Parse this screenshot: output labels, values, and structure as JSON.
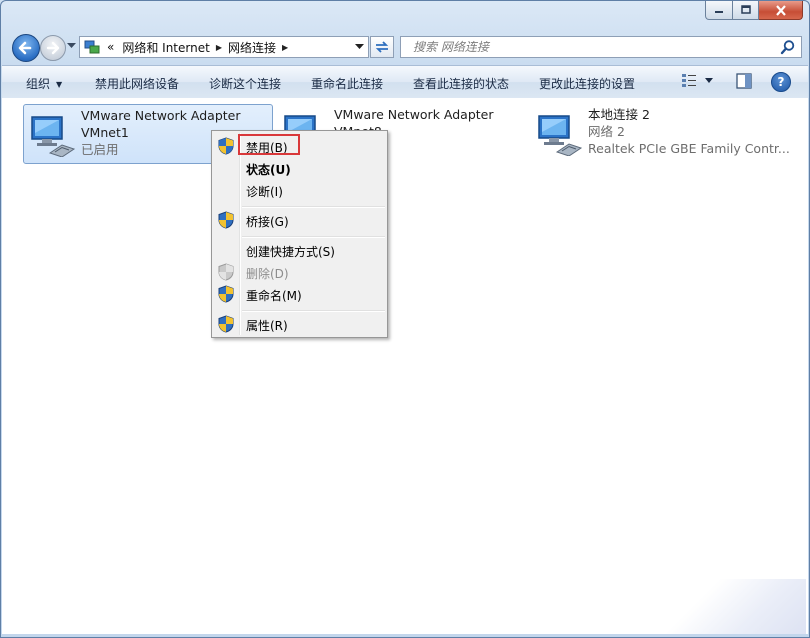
{
  "window": {
    "caption_buttons": [
      "minimize",
      "maximize",
      "close"
    ]
  },
  "navigation": {
    "breadcrumb": {
      "overflow": "«",
      "items": [
        "网络和 Internet",
        "网络连接"
      ]
    },
    "search_placeholder": "搜索 网络连接"
  },
  "commandbar": {
    "organize": "组织",
    "items": [
      "禁用此网络设备",
      "诊断这个连接",
      "重命名此连接",
      "查看此连接的状态",
      "更改此连接的设置"
    ],
    "help": "?"
  },
  "adapters": [
    {
      "name": "VMware Network Adapter",
      "line2": "VMnet1",
      "status": "已启用",
      "selected": true
    },
    {
      "name": "VMware Network Adapter",
      "line2": "VMnet8",
      "status": ""
    },
    {
      "name": "本地连接 2",
      "line2": "网络  2",
      "status": "Realtek PCIe GBE Family Contr..."
    }
  ],
  "context_menu": {
    "items": [
      {
        "label": "禁用(B)",
        "icon": "shield-icon",
        "bold": false,
        "disabled": false,
        "highlighted": true
      },
      {
        "label": "状态(U)",
        "icon": "",
        "bold": true,
        "disabled": false
      },
      {
        "label": "诊断(I)",
        "icon": "",
        "bold": false,
        "disabled": false
      },
      {
        "label": "桥接(G)",
        "icon": "shield-icon",
        "bold": false,
        "disabled": false
      },
      {
        "label": "创建快捷方式(S)",
        "icon": "",
        "bold": false,
        "disabled": false
      },
      {
        "label": "删除(D)",
        "icon": "shield-icon",
        "bold": false,
        "disabled": true
      },
      {
        "label": "重命名(M)",
        "icon": "shield-icon",
        "bold": false,
        "disabled": false
      },
      {
        "label": "属性(R)",
        "icon": "shield-icon",
        "bold": false,
        "disabled": false
      }
    ]
  },
  "colors": {
    "highlight_border": "#d9383a",
    "selection": "#cfe3fa"
  }
}
